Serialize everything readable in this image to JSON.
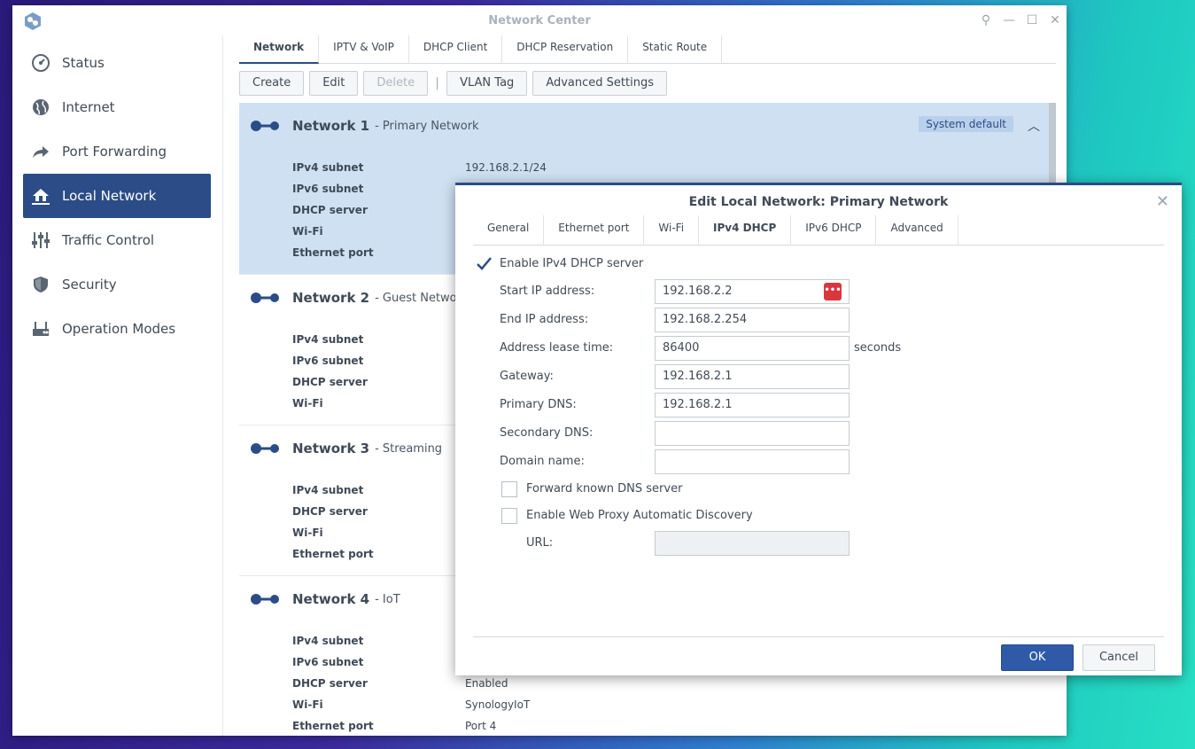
{
  "window": {
    "title": "Network Center"
  },
  "sidebar": {
    "items": [
      {
        "label": "Status",
        "icon": "gauge-icon"
      },
      {
        "label": "Internet",
        "icon": "globe-icon"
      },
      {
        "label": "Port Forwarding",
        "icon": "share-arrow-icon"
      },
      {
        "label": "Local Network",
        "icon": "home-network-icon",
        "active": true
      },
      {
        "label": "Traffic Control",
        "icon": "sliders-icon"
      },
      {
        "label": "Security",
        "icon": "shield-icon"
      },
      {
        "label": "Operation Modes",
        "icon": "router-icon"
      }
    ]
  },
  "tabs": [
    "Network",
    "IPTV & VoIP",
    "DHCP Client",
    "DHCP Reservation",
    "Static Route"
  ],
  "toolbar": {
    "create": "Create",
    "edit": "Edit",
    "delete": "Delete",
    "vlan": "VLAN Tag",
    "advanced": "Advanced Settings"
  },
  "networks": [
    {
      "name": "Network 1",
      "desc": "- Primary Network",
      "badge": "System default",
      "props": [
        {
          "k": "IPv4 subnet",
          "v": "192.168.2.1/24"
        },
        {
          "k": "IPv6 subnet",
          "v": ""
        },
        {
          "k": "DHCP server",
          "v": ""
        },
        {
          "k": "Wi-Fi",
          "v": ""
        },
        {
          "k": "Ethernet port",
          "v": ""
        }
      ]
    },
    {
      "name": "Network 2",
      "desc": "- Guest Network",
      "props": [
        {
          "k": "IPv4 subnet",
          "v": ""
        },
        {
          "k": "IPv6 subnet",
          "v": ""
        },
        {
          "k": "DHCP server",
          "v": ""
        },
        {
          "k": "Wi-Fi",
          "v": ""
        }
      ]
    },
    {
      "name": "Network 3",
      "desc": "- Streaming",
      "props": [
        {
          "k": "IPv4 subnet",
          "v": ""
        },
        {
          "k": "DHCP server",
          "v": ""
        },
        {
          "k": "Wi-Fi",
          "v": ""
        },
        {
          "k": "Ethernet port",
          "v": ""
        }
      ]
    },
    {
      "name": "Network 4",
      "desc": "- IoT",
      "props": [
        {
          "k": "IPv4 subnet",
          "v": ""
        },
        {
          "k": "IPv6 subnet",
          "v": ""
        },
        {
          "k": "DHCP server",
          "v": "Enabled"
        },
        {
          "k": "Wi-Fi",
          "v": "SynologyIoT"
        },
        {
          "k": "Ethernet port",
          "v": "Port 4"
        }
      ]
    }
  ],
  "dialog": {
    "title": "Edit Local Network: Primary Network",
    "tabs": [
      "General",
      "Ethernet port",
      "Wi-Fi",
      "IPv4 DHCP",
      "IPv6 DHCP",
      "Advanced"
    ],
    "active_tab": "IPv4 DHCP",
    "enable_dhcp": {
      "label": "Enable IPv4 DHCP server",
      "checked": true
    },
    "fields": [
      {
        "label": "Start IP address:",
        "value": "192.168.2.2"
      },
      {
        "label": "End IP address:",
        "value": "192.168.2.254"
      },
      {
        "label": "Address lease time:",
        "value": "86400",
        "suffix": "seconds"
      },
      {
        "label": "Gateway:",
        "value": "192.168.2.1"
      },
      {
        "label": "Primary DNS:",
        "value": "192.168.2.1"
      },
      {
        "label": "Secondary DNS:",
        "value": ""
      },
      {
        "label": "Domain name:",
        "value": ""
      }
    ],
    "forward_dns": {
      "label": "Forward known DNS server",
      "checked": false
    },
    "wpad": {
      "label": "Enable Web Proxy Automatic Discovery",
      "checked": false
    },
    "url": {
      "label": "URL:",
      "value": ""
    },
    "ok": "OK",
    "cancel": "Cancel"
  },
  "colors": {
    "accent": "#2b4c86",
    "ok_button": "#2f5aa8",
    "selected_row": "#cfe0f2",
    "password_badge": "#d9363e"
  }
}
